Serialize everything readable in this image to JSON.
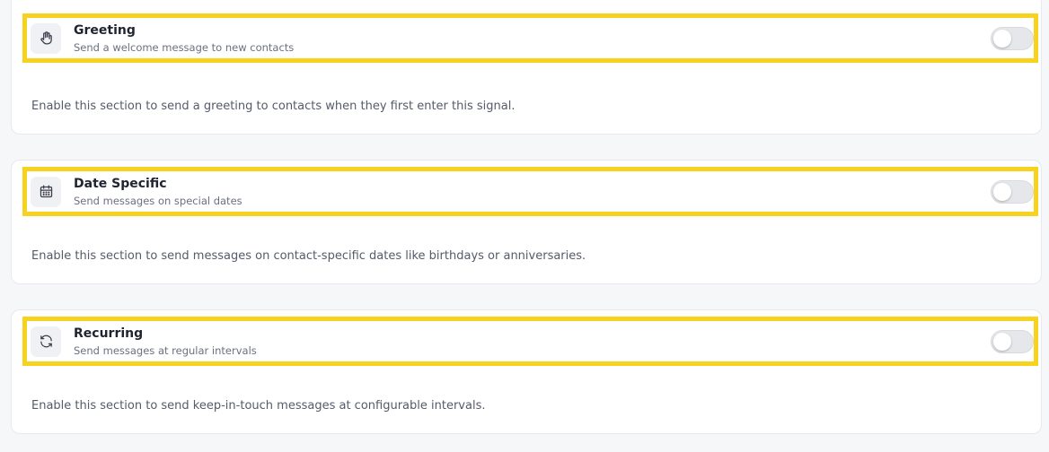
{
  "sections": [
    {
      "icon": "hand-icon",
      "title": "Greeting",
      "subtitle": "Send a welcome message to new contacts",
      "description": "Enable this section to send a greeting to contacts when they first enter this signal.",
      "enabled": false
    },
    {
      "icon": "calendar-icon",
      "title": "Date Specific",
      "subtitle": "Send messages on special dates",
      "description": "Enable this section to send messages on contact-specific dates like birthdays or anniversaries.",
      "enabled": false
    },
    {
      "icon": "refresh-icon",
      "title": "Recurring",
      "subtitle": "Send messages at regular intervals",
      "description": "Enable this section to send keep-in-touch messages at configurable intervals.",
      "enabled": false
    }
  ],
  "colors": {
    "highlight": "#f7d21e",
    "toggle_off": "#e6e7ea"
  }
}
